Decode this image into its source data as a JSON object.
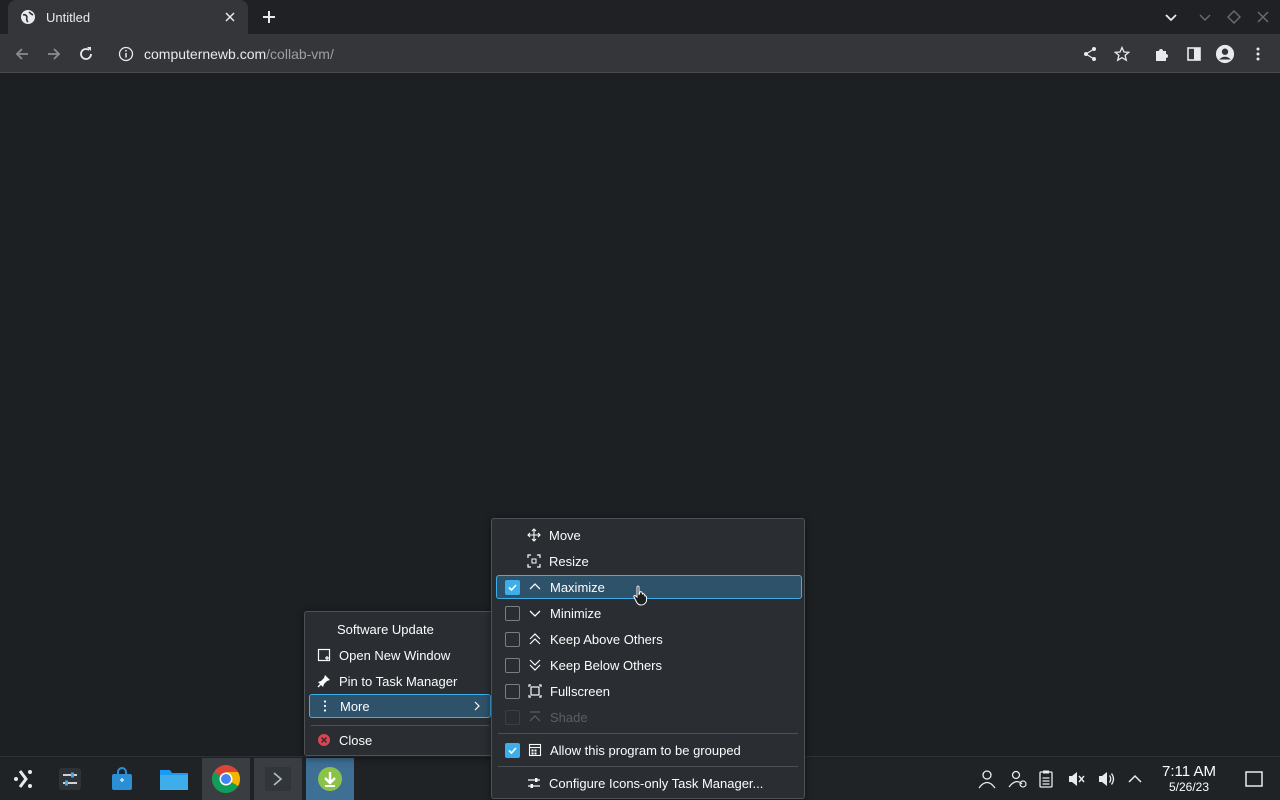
{
  "browser": {
    "tab_title": "Untitled",
    "url_host": "computernewb.com",
    "url_path": "/collab-vm/"
  },
  "context_menu": {
    "items": [
      {
        "label": "Software Update",
        "icon": "none"
      },
      {
        "label": "Open New Window",
        "icon": "new-window-icon"
      },
      {
        "label": "Pin to Task Manager",
        "icon": "pin-icon"
      },
      {
        "label": "More",
        "icon": "more-vertical-icon"
      },
      {
        "label": "Close",
        "icon": "close-circle-icon"
      }
    ]
  },
  "submenu": {
    "items": [
      {
        "label": "Move",
        "icon": "move-icon"
      },
      {
        "label": "Resize",
        "icon": "resize-icon"
      },
      {
        "label": "Maximize",
        "icon": "maximize-icon",
        "checked": true
      },
      {
        "label": "Minimize",
        "icon": "minimize-icon",
        "checked": false
      },
      {
        "label": "Keep Above Others",
        "icon": "keep-above-icon",
        "checked": false
      },
      {
        "label": "Keep Below Others",
        "icon": "keep-below-icon",
        "checked": false
      },
      {
        "label": "Fullscreen",
        "icon": "fullscreen-icon",
        "checked": false
      },
      {
        "label": "Shade",
        "icon": "shade-icon",
        "checked": false,
        "disabled": true
      },
      {
        "label": "Allow this program to be grouped",
        "icon": "grouping-icon",
        "checked": true
      },
      {
        "label": "Configure Icons-only Task Manager...",
        "icon": "configure-icon"
      }
    ]
  },
  "taskbar": {
    "time": "7:11 AM",
    "date": "5/26/23"
  },
  "colors": {
    "accent": "#3daee9",
    "menu_bg": "#2a2e32",
    "page_bg": "#1d2023",
    "highlight": "#2f526b"
  }
}
